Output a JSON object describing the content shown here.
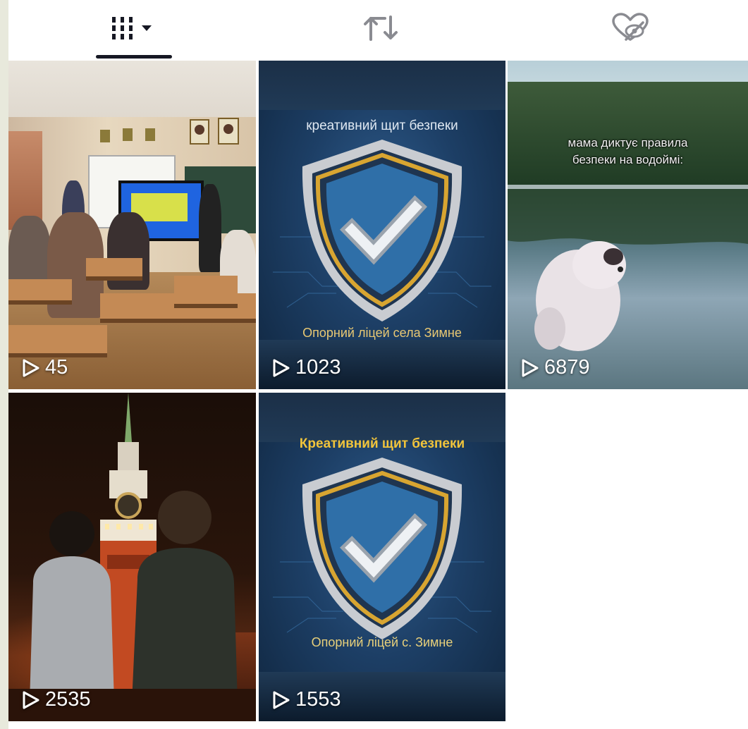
{
  "tabs": {
    "videos": {
      "icon": "grid-icon",
      "dropdown_icon": "caret-down-icon",
      "active": true
    },
    "reposts": {
      "icon": "repost-icon"
    },
    "liked": {
      "icon": "hidden-likes-icon"
    }
  },
  "videos": [
    {
      "views": "45",
      "captions": []
    },
    {
      "views": "1023",
      "captions": [
        "креативний щит безпеки",
        "Опорний ліцей села Зимне"
      ]
    },
    {
      "views": "6879",
      "captions": [
        "мама диктує правила",
        "безпеки на водоймі:"
      ]
    },
    {
      "views": "2535",
      "captions": []
    },
    {
      "views": "1553",
      "captions": [
        "Креативний щит безпеки",
        "Опорний ліцей с. Зимне"
      ]
    }
  ],
  "colors": {
    "background": "#ffffff",
    "outer": "#e8e9dc",
    "tab_active": "#161823",
    "tab_inactive": "#8a8b91",
    "shield_blue": "#2f6fa8",
    "shield_gold": "#d8a531"
  }
}
